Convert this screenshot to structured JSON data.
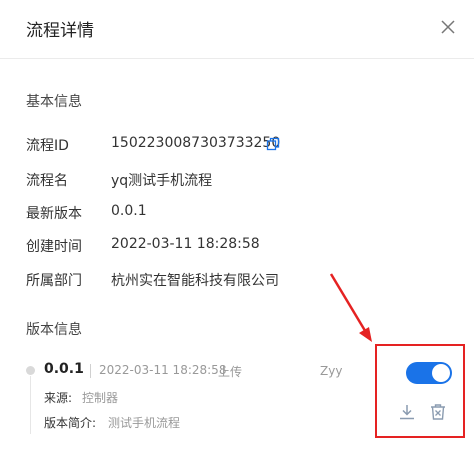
{
  "dialog": {
    "title": "流程详情",
    "close_icon": "close-icon"
  },
  "basic_info": {
    "section_title": "基本信息",
    "fields": [
      {
        "label": "流程ID",
        "value": "1502230087303733250"
      },
      {
        "label": "流程名",
        "value": "yq测试手机流程"
      },
      {
        "label": "最新版本",
        "value": "0.0.1"
      },
      {
        "label": "创建时间",
        "value": "2022-03-11 18:28:58"
      },
      {
        "label": "所属部门",
        "value": "杭州实在智能科技有限公司"
      }
    ],
    "copy_icon": "copy-icon"
  },
  "version_info": {
    "section_title": "版本信息",
    "versions": [
      {
        "version": "0.0.1",
        "time": "2022-03-11 18:28:58",
        "action": "上传",
        "user": "Zyy",
        "source_label": "来源:",
        "source_value": "控制器",
        "summary_label": "版本简介:",
        "summary_value": "测试手机流程",
        "enabled": true,
        "download_icon": "download-icon",
        "delete_icon": "delete-icon"
      }
    ]
  },
  "colors": {
    "accent": "#1a73e8",
    "annotation": "#e52222"
  }
}
